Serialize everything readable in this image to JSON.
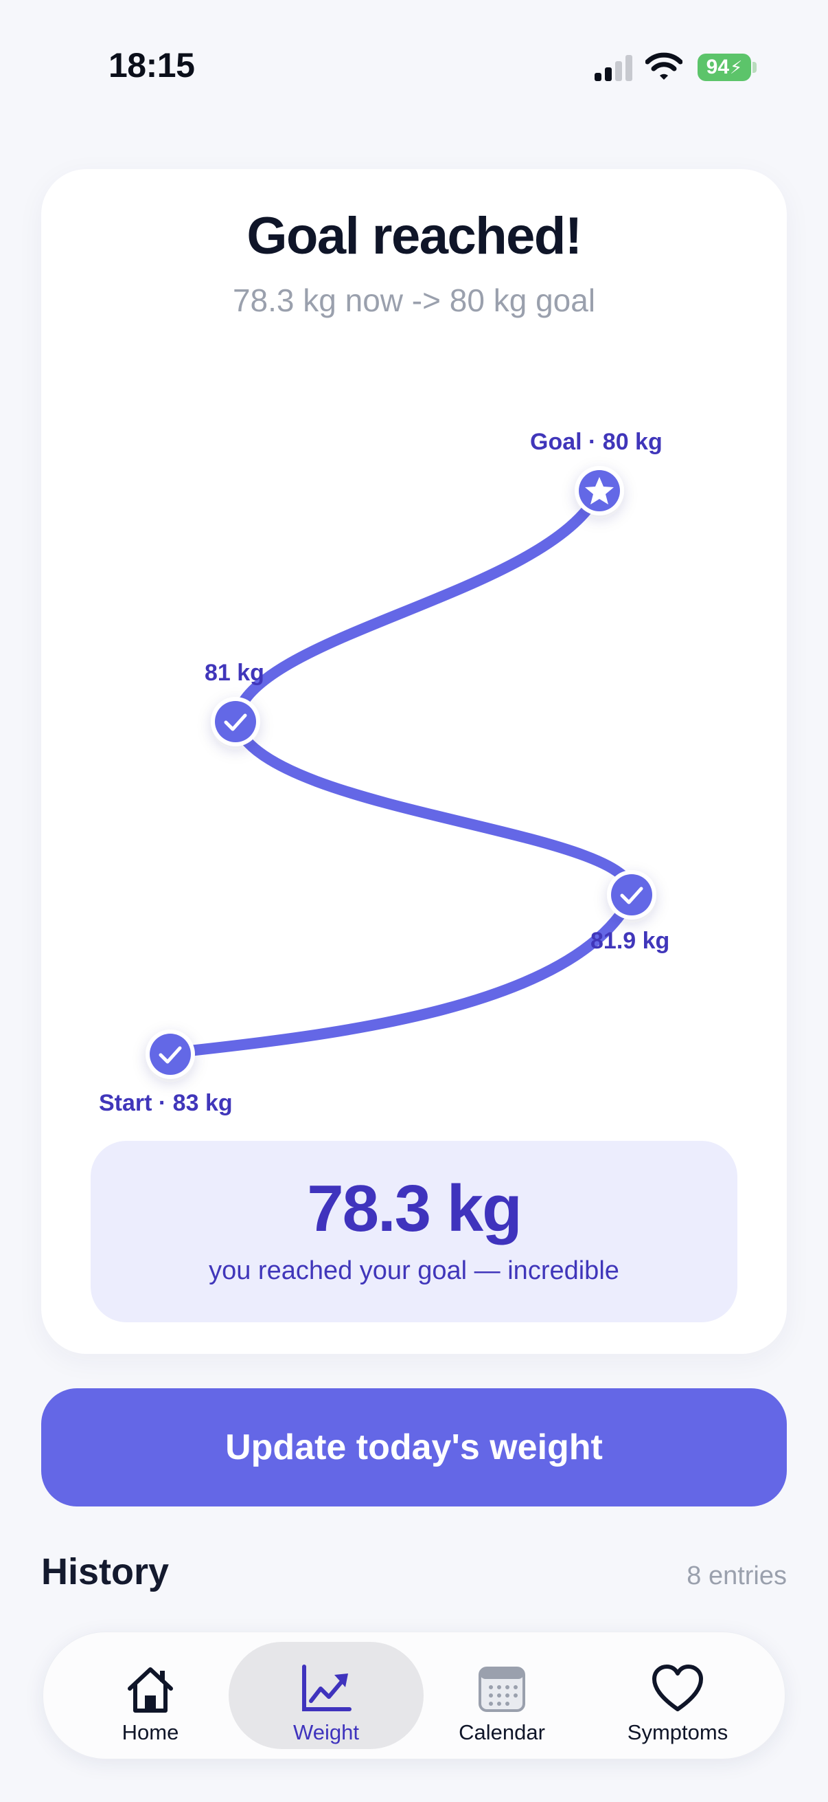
{
  "status_bar": {
    "time": "18:15",
    "battery": "94"
  },
  "card": {
    "title": "Goal reached!",
    "subtitle": "78.3 kg now -> 80 kg goal",
    "milestones": [
      {
        "label": "Goal · 80 kg",
        "icon": "star-icon"
      },
      {
        "label": "81 kg",
        "icon": "check-icon"
      },
      {
        "label": "81.9 kg",
        "icon": "check-icon"
      },
      {
        "label": "Start · 83 kg",
        "icon": "check-icon"
      }
    ],
    "result_value": "78.3 kg",
    "result_caption": "you reached your goal — incredible"
  },
  "cta": {
    "label": "Update today's weight"
  },
  "history": {
    "title": "History",
    "count": "8 entries"
  },
  "tabs": [
    {
      "label": "Home",
      "icon": "home-icon",
      "active": false
    },
    {
      "label": "Weight",
      "icon": "weight-chart-icon",
      "active": true
    },
    {
      "label": "Calendar",
      "icon": "calendar-icon",
      "active": false
    },
    {
      "label": "Symptoms",
      "icon": "heart-icon",
      "active": false
    }
  ],
  "colors": {
    "accent": "#6467e6",
    "accent_dark": "#3f33bd",
    "accent_light": "#ecedfd",
    "battery": "#5cc46a",
    "muted": "#9aa0ad"
  }
}
